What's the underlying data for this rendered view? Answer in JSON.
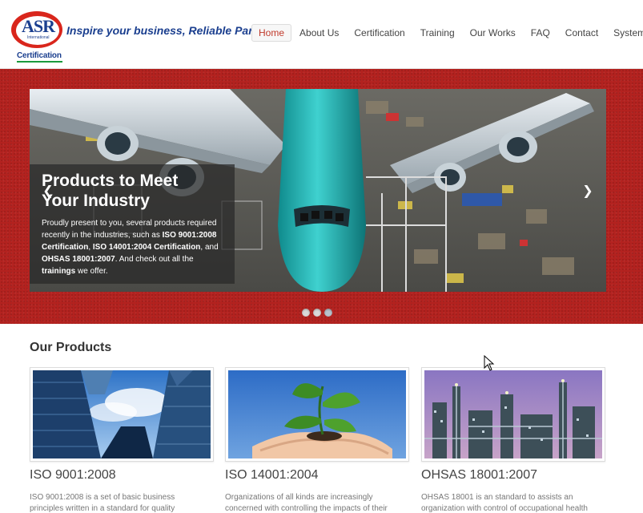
{
  "header": {
    "logo": {
      "brand": "ASR",
      "sub": "International",
      "label": "Certification"
    },
    "tagline": "Inspire your business, Reliable Partner",
    "nav": [
      {
        "label": "Home",
        "active": true
      },
      {
        "label": "About Us"
      },
      {
        "label": "Certification"
      },
      {
        "label": "Training"
      },
      {
        "label": "Our Works"
      },
      {
        "label": "FAQ"
      },
      {
        "label": "Contact"
      },
      {
        "label": "System"
      }
    ]
  },
  "slider": {
    "title_line1": "Products to Meet",
    "title_line2": "Your Industry",
    "text": {
      "t1": "Proudly present to you, several products required recently in the industries, such as ",
      "b1": "ISO 9001:2008 Certification",
      "t2": ", ",
      "b2": "ISO 14001:2004 Certification",
      "t3": ", and ",
      "b3": "OHSAS 18001:2007",
      "t4": ". And check out all the ",
      "b4": "trainings",
      "t5": " we offer."
    },
    "prev_icon": "chevron-left-icon",
    "next_icon": "chevron-right-icon",
    "slide_count": 3,
    "active_slide": 3
  },
  "products": {
    "section_title": "Our Products",
    "items": [
      {
        "title": "ISO 9001:2008",
        "desc_line1": "ISO 9001:2008 is a set of basic business",
        "desc_line2": "principles written in a standard for quality",
        "image": "skyscrapers"
      },
      {
        "title": "ISO 14001:2004",
        "desc_line1": "Organizations of all kinds are increasingly",
        "desc_line2": "concerned with controlling the impacts of their",
        "image": "plant-in-hands"
      },
      {
        "title": "OHSAS 18001:2007",
        "desc_line1": "OHSAS 18001 is an standard to assists an",
        "desc_line2": "organization with control of occupational health",
        "image": "industrial-plant"
      }
    ]
  },
  "colors": {
    "banner_red": "#b3221f",
    "brand_blue": "#1b3f8f",
    "logo_red": "#d9261c",
    "active_nav": "#c0392b"
  }
}
